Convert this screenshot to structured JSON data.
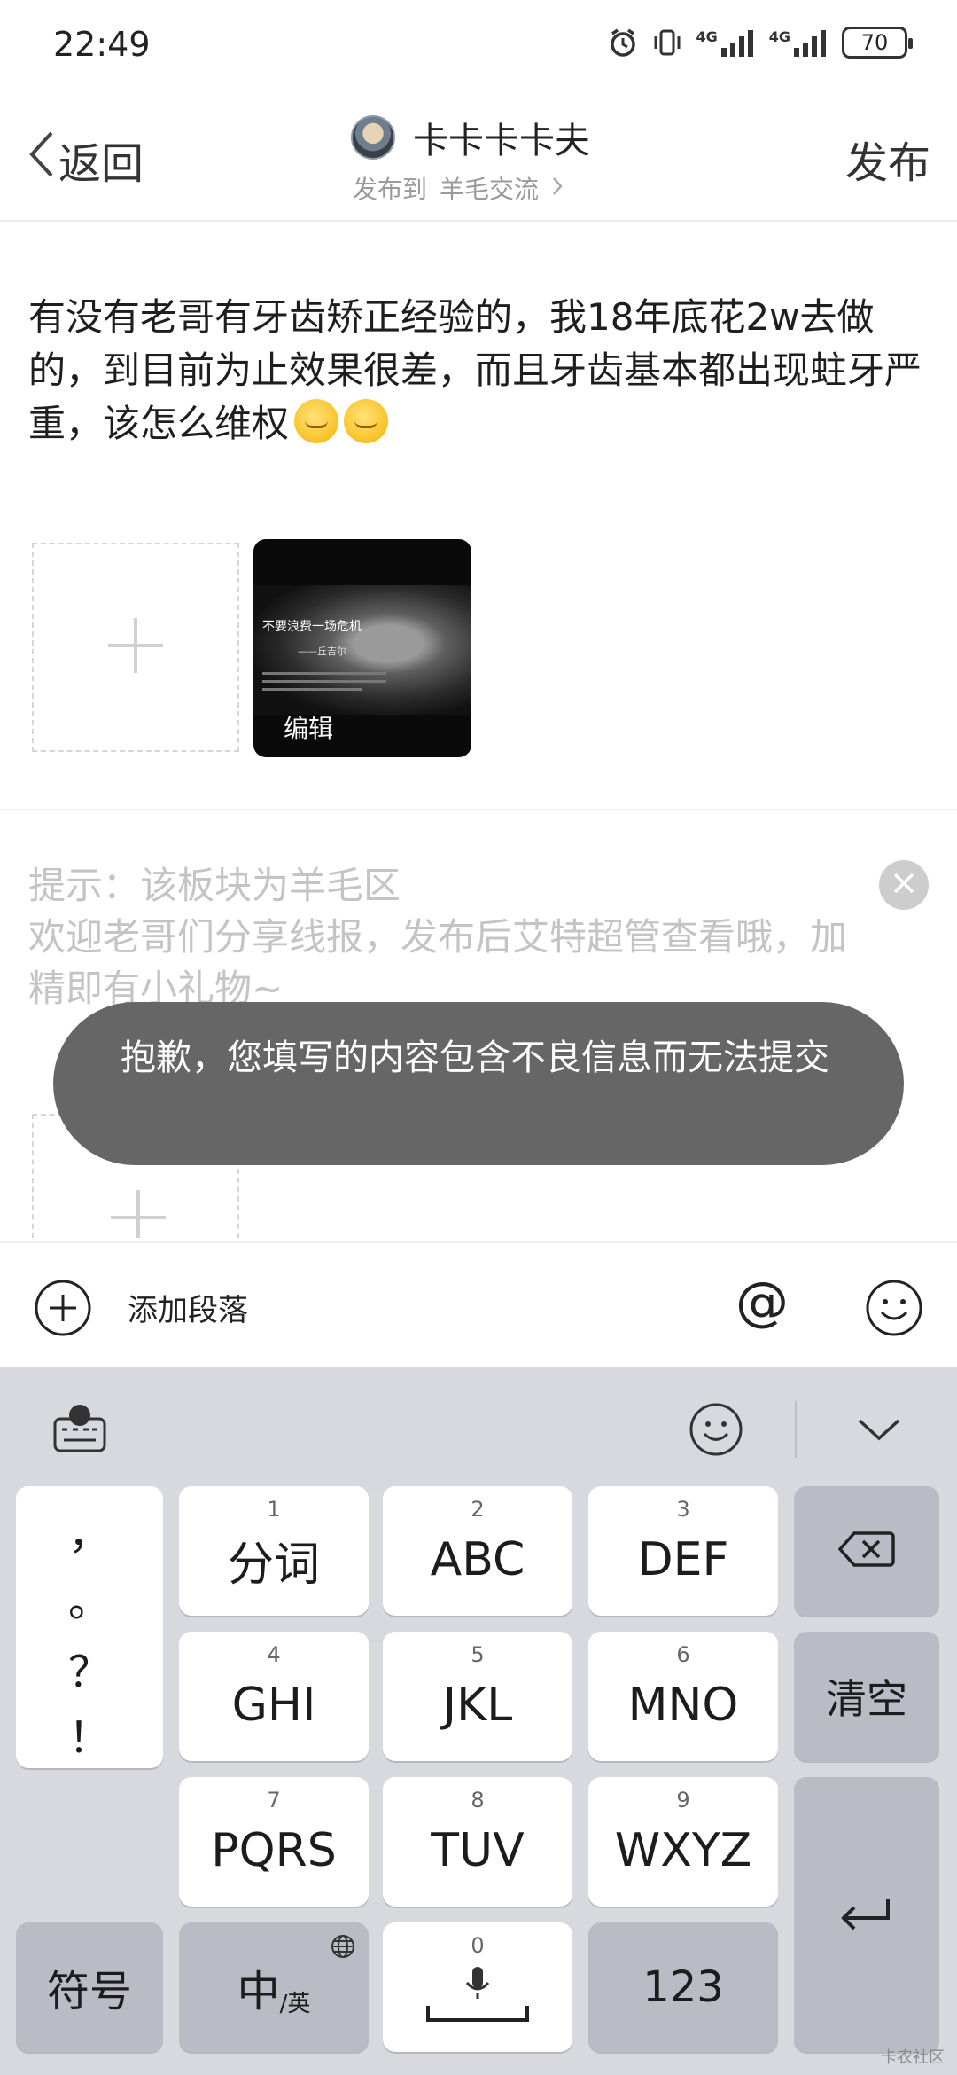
{
  "status_bar": {
    "time": "22:49",
    "network_1": "4G",
    "network_2": "4G",
    "battery": "70"
  },
  "header": {
    "back_label": "返回",
    "username": "卡卡卡卡夫",
    "publish_to_label": "发布到",
    "board_name": "羊毛交流",
    "publish_button": "发布"
  },
  "post": {
    "text": "有没有老哥有牙齿矫正经验的，我18年底花2w去做的，到目前为止效果很差，而且牙齿基本都出现蛀牙严重，该怎么维权",
    "emoji_count": 2
  },
  "image_thumb": {
    "title": "不要浪费一场危机",
    "attribution": "——丘吉尔",
    "edit_label": "编辑"
  },
  "hint": {
    "line1": "提示：该板块为羊毛区",
    "line2": "欢迎老哥们分享线报，发布后艾特超管查看哦，加精即有小礼物~"
  },
  "toast": {
    "message": "抱歉，您填写的内容包含不良信息而无法提交"
  },
  "toolbar": {
    "add_paragraph_label": "添加段落",
    "at_symbol": "@"
  },
  "keyboard": {
    "punctuation": [
      "，",
      "。",
      "？",
      "！"
    ],
    "rows": [
      [
        {
          "num": "1",
          "label": "分词"
        },
        {
          "num": "2",
          "label": "ABC"
        },
        {
          "num": "3",
          "label": "DEF"
        }
      ],
      [
        {
          "num": "4",
          "label": "GHI"
        },
        {
          "num": "5",
          "label": "JKL"
        },
        {
          "num": "6",
          "label": "MNO"
        }
      ],
      [
        {
          "num": "7",
          "label": "PQRS"
        },
        {
          "num": "8",
          "label": "TUV"
        },
        {
          "num": "9",
          "label": "WXYZ"
        }
      ]
    ],
    "clear_label": "清空",
    "symbol_label": "符号",
    "lang_main": "中",
    "lang_sub": "/英",
    "space_num": "0",
    "numbers_label": "123"
  },
  "watermark": "卡农社区"
}
